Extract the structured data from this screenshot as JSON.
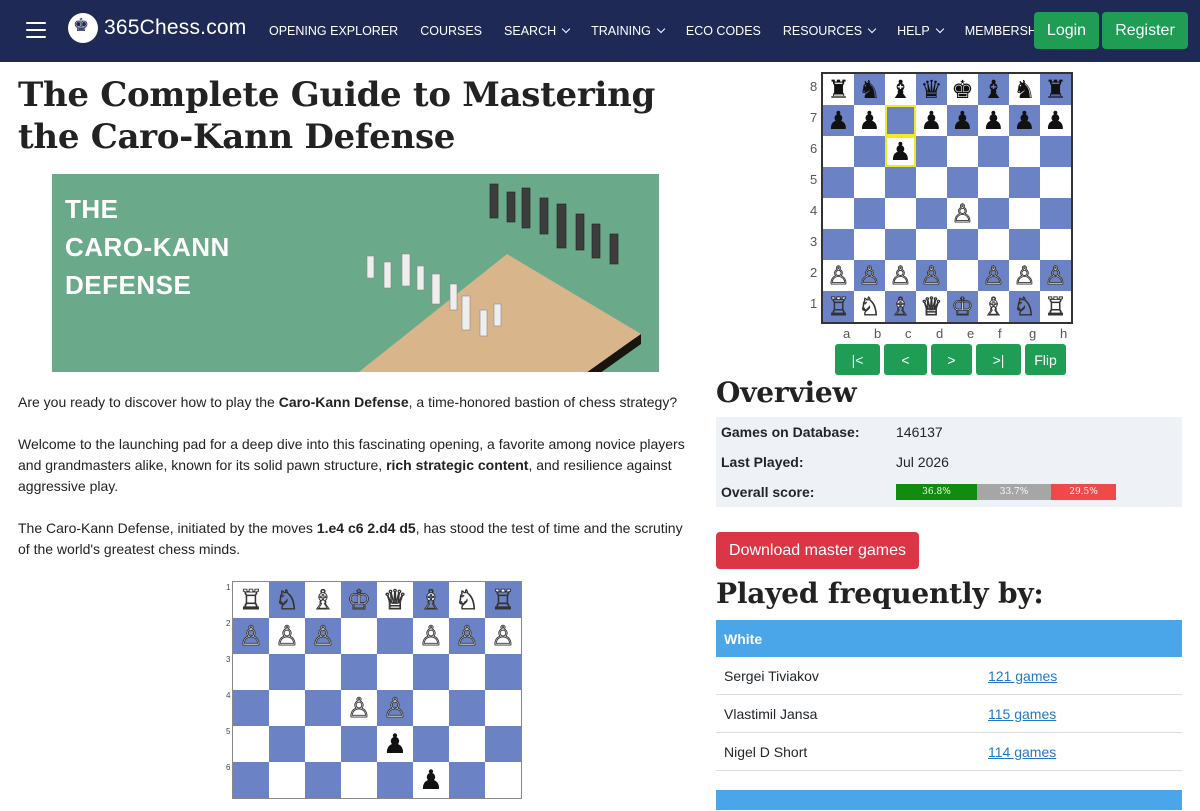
{
  "nav": {
    "logo_text": "365Chess.com",
    "logo_glyph": "♚",
    "items": [
      {
        "label": "OPENING EXPLORER",
        "dropdown": false
      },
      {
        "label": "COURSES",
        "dropdown": false
      },
      {
        "label": "SEARCH",
        "dropdown": true
      },
      {
        "label": "TRAINING",
        "dropdown": true
      },
      {
        "label": "ECO CODES",
        "dropdown": false
      },
      {
        "label": "RESOURCES",
        "dropdown": true
      },
      {
        "label": "HELP",
        "dropdown": true
      },
      {
        "label": "MEMBERSHIP",
        "dropdown": false
      }
    ],
    "login": "Login",
    "register": "Register"
  },
  "article": {
    "title": "The Complete Guide to Mastering the Caro-Kann Defense",
    "hero_text": [
      "THE",
      "CARO-KANN",
      "DEFENSE"
    ],
    "p1_before": "Are you ready to discover how to play the ",
    "p1_bold": "Caro-Kann Defense",
    "p1_after": ", a time-honored bastion of chess strategy?",
    "p2_before": "Welcome to the launching pad for a deep dive into this fascinating opening, a favorite among novice players and grandmasters alike, known for its solid pawn structure, ",
    "p2_bold": "rich strategic content",
    "p2_after": ", and resilience against aggressive play.",
    "p3_before": "The Caro-Kann Defense, initiated by the moves ",
    "p3_bold": "1.e4 c6 2.d4 d5",
    "p3_after": ", has stood the test of time and the scrutiny of the world's greatest chess minds.",
    "small_board": {
      "ranks": [
        "1",
        "2",
        "3",
        "4",
        "5",
        "6"
      ],
      "rows": [
        [
          "R",
          "N",
          "B",
          "K",
          "Q",
          "B",
          "N",
          "R"
        ],
        [
          "P",
          "P",
          "P",
          "",
          "",
          "P",
          "P",
          "P"
        ],
        [
          "",
          "",
          "",
          "",
          "",
          "",
          "",
          ""
        ],
        [
          "",
          "",
          "",
          "P",
          "P",
          "",
          "",
          ""
        ],
        [
          "",
          "",
          "",
          "",
          "p",
          "",
          "",
          ""
        ],
        [
          "",
          "",
          "",
          "",
          "",
          "p",
          "",
          ""
        ]
      ]
    }
  },
  "board": {
    "ranks": [
      "8",
      "7",
      "6",
      "5",
      "4",
      "3",
      "2",
      "1"
    ],
    "files": [
      "a",
      "b",
      "c",
      "d",
      "e",
      "f",
      "g",
      "h"
    ],
    "rows": [
      [
        "r",
        "n",
        "b",
        "q",
        "k",
        "b",
        "n",
        "r"
      ],
      [
        "p",
        "p",
        "",
        "p",
        "p",
        "p",
        "p",
        "p"
      ],
      [
        "",
        "",
        "p",
        "",
        "",
        "",
        "",
        ""
      ],
      [
        "",
        "",
        "",
        "",
        "",
        "",
        "",
        ""
      ],
      [
        "",
        "",
        "",
        "",
        "P",
        "",
        "",
        ""
      ],
      [
        "",
        "",
        "",
        "",
        "",
        "",
        "",
        ""
      ],
      [
        "P",
        "P",
        "P",
        "P",
        "",
        "P",
        "P",
        "P"
      ],
      [
        "R",
        "N",
        "B",
        "Q",
        "K",
        "B",
        "N",
        "R"
      ]
    ],
    "highlighted": [
      "c7",
      "c6"
    ],
    "controls": [
      "|<",
      "<",
      ">",
      ">|",
      "Flip"
    ]
  },
  "overview": {
    "heading": "Overview",
    "games_label": "Games on Database:",
    "games_value": "146137",
    "last_label": "Last Played:",
    "last_value": "Jul 2026",
    "score_label": "Overall score:",
    "score": {
      "white": "36.8%",
      "draw": "33.7%",
      "black": "29.5%",
      "white_frac": 0.368,
      "draw_frac": 0.337,
      "black_frac": 0.295
    },
    "colors": {
      "white": "#118c0f",
      "draw": "#a6a6a6",
      "black": "#ef4949"
    }
  },
  "download": "Download master games",
  "played": {
    "heading": "Played frequently by:",
    "white_header": "White",
    "players": [
      {
        "name": "Sergei Tiviakov",
        "games": "121 games"
      },
      {
        "name": "Vlastimil Jansa",
        "games": "115 games"
      },
      {
        "name": "Nigel D Short",
        "games": "114 games"
      }
    ]
  }
}
